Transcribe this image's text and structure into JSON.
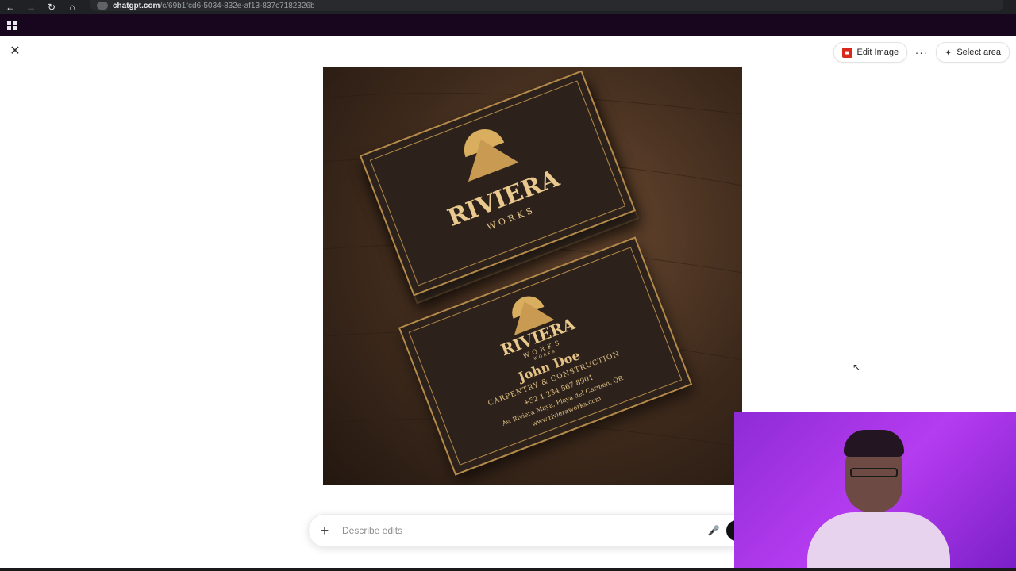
{
  "browser": {
    "url_host": "chatgpt.com",
    "url_path": "/c/69b1fcd6-5034-832e-af13-837c7182326b"
  },
  "toolbar": {
    "edit_image_label": "Edit Image",
    "more_label": "···",
    "select_area_label": "Select area"
  },
  "image": {
    "card_top": {
      "brand": "RIVIERA",
      "brand_sub": "WORKS"
    },
    "card_bottom": {
      "brand": "RIVIERA",
      "brand_sub": "WORKS",
      "brand_sub_small": "WORKS",
      "name": "John Doe",
      "role": "CARPENTRY & CONSTRUCTION",
      "phone": "+52 1 234 567 8901",
      "address": "Av. Riviera Maya, Playa del Carmen, QR",
      "website": "www.rivieraworks.com"
    }
  },
  "prompt": {
    "placeholder": "Describe edits"
  }
}
